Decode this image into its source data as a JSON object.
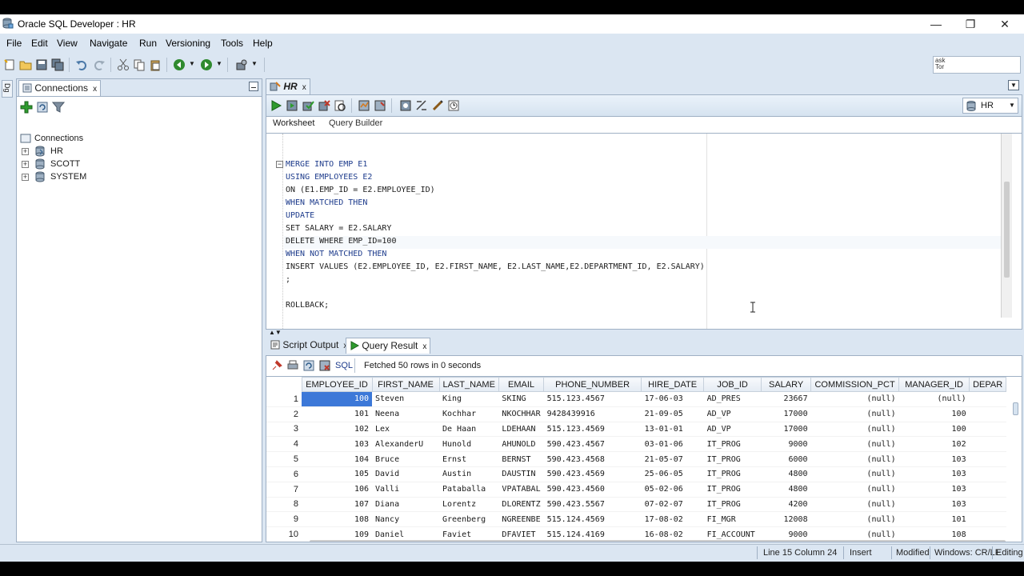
{
  "window": {
    "title": "Oracle SQL Developer : HR",
    "minimize": "—",
    "restore": "❐",
    "close": "✕"
  },
  "menu": [
    "File",
    "Edit",
    "View",
    "Navigate",
    "Run",
    "Versioning",
    "Tools",
    "Help"
  ],
  "search": {
    "text": "ask\nTor"
  },
  "left_strip": {
    "tab": "Dg"
  },
  "connections_panel": {
    "tab_label": "Connections",
    "tab_close": "x",
    "root_label": "Connections",
    "items": [
      "HR",
      "SCOTT",
      "SYSTEM"
    ],
    "expander": "+"
  },
  "editor": {
    "tab_label": "HR",
    "tab_close": "x",
    "connection_select": "HR",
    "subtabs": [
      "Worksheet",
      "Query Builder"
    ],
    "collapse_marker": "−",
    "code_lines": [
      "MERGE INTO EMP E1",
      "USING EMPLOYEES E2",
      "ON (E1.EMP_ID = E2.EMPLOYEE_ID)",
      "WHEN MATCHED THEN",
      "UPDATE",
      "SET SALARY = E2.SALARY",
      "DELETE WHERE EMP_ID=100",
      "WHEN NOT MATCHED THEN",
      "INSERT VALUES (E2.EMPLOYEE_ID, E2.FIRST_NAME, E2.LAST_NAME,E2.DEPARTMENT_ID, E2.SALARY)",
      ";",
      "",
      "ROLLBACK;"
    ]
  },
  "results": {
    "tabs": [
      {
        "label": "Script Output",
        "close": "x"
      },
      {
        "label": "Query Result",
        "close": "x"
      }
    ],
    "sql_label": "SQL",
    "status": "Fetched 50 rows in 0 seconds",
    "columns": [
      "EMPLOYEE_ID",
      "FIRST_NAME",
      "LAST_NAME",
      "EMAIL",
      "PHONE_NUMBER",
      "HIRE_DATE",
      "JOB_ID",
      "SALARY",
      "COMMISSION_PCT",
      "MANAGER_ID",
      "DEPAR"
    ],
    "rows": [
      [
        "1",
        "100",
        "Steven",
        "King",
        "SKING",
        "515.123.4567",
        "17-06-03",
        "AD_PRES",
        "23667",
        "(null)",
        "(null)"
      ],
      [
        "2",
        "101",
        "Neena",
        "Kochhar",
        "NKOCHHAR",
        "9428439916",
        "21-09-05",
        "AD_VP",
        "17000",
        "(null)",
        "100"
      ],
      [
        "3",
        "102",
        "Lex",
        "De Haan",
        "LDEHAAN",
        "515.123.4569",
        "13-01-01",
        "AD_VP",
        "17000",
        "(null)",
        "100"
      ],
      [
        "4",
        "103",
        "AlexanderU",
        "Hunold",
        "AHUNOLD",
        "590.423.4567",
        "03-01-06",
        "IT_PROG",
        "9000",
        "(null)",
        "102"
      ],
      [
        "5",
        "104",
        "Bruce",
        "Ernst",
        "BERNST",
        "590.423.4568",
        "21-05-07",
        "IT_PROG",
        "6000",
        "(null)",
        "103"
      ],
      [
        "6",
        "105",
        "David",
        "Austin",
        "DAUSTIN",
        "590.423.4569",
        "25-06-05",
        "IT_PROG",
        "4800",
        "(null)",
        "103"
      ],
      [
        "7",
        "106",
        "Valli",
        "Pataballa",
        "VPATABAL",
        "590.423.4560",
        "05-02-06",
        "IT_PROG",
        "4800",
        "(null)",
        "103"
      ],
      [
        "8",
        "107",
        "Diana",
        "Lorentz",
        "DLORENTZ",
        "590.423.5567",
        "07-02-07",
        "IT_PROG",
        "4200",
        "(null)",
        "103"
      ],
      [
        "9",
        "108",
        "Nancy",
        "Greenberg",
        "NGREENBE",
        "515.124.4569",
        "17-08-02",
        "FI_MGR",
        "12008",
        "(null)",
        "101"
      ],
      [
        "10",
        "109",
        "Daniel",
        "Faviet",
        "DFAVIET",
        "515.124.4169",
        "16-08-02",
        "FI_ACCOUNT",
        "9000",
        "(null)",
        "108"
      ]
    ]
  },
  "statusbar": {
    "position": "Line 15 Column 24",
    "mode": "Insert",
    "modified": "Modified",
    "eol": "Windows: CR/LF",
    "state": "Editing"
  },
  "colors": {
    "chrome": "#dbe6f2",
    "selection": "#3c78d8",
    "keyword": "#1e3c8c"
  }
}
